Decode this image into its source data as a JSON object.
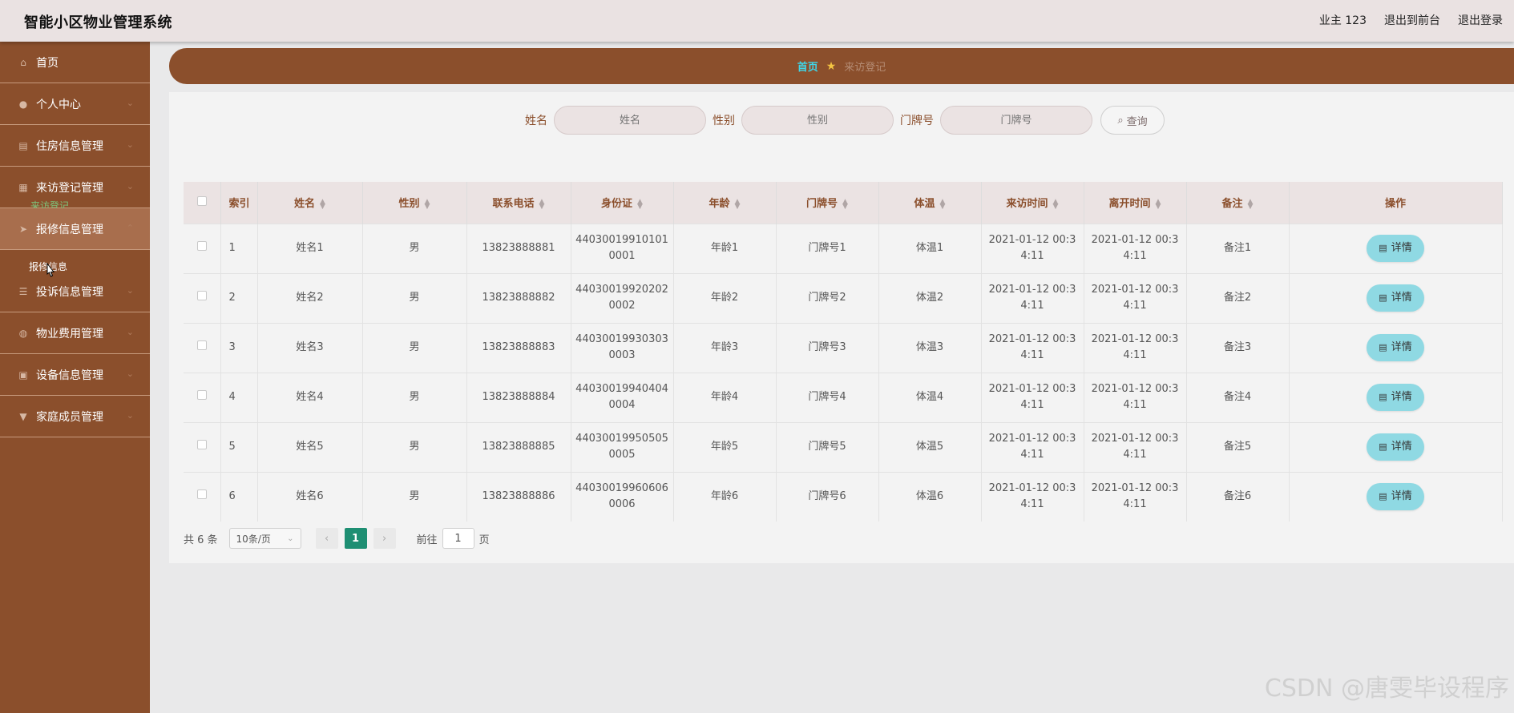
{
  "header": {
    "title": "智能小区物业管理系统",
    "links": [
      "业主 123",
      "退出到前台",
      "退出登录"
    ]
  },
  "sidebar": {
    "items": [
      {
        "label": "首页",
        "icon": "home-icon"
      },
      {
        "label": "个人中心",
        "icon": "user-icon"
      },
      {
        "label": "住房信息管理",
        "icon": "clipboard-icon"
      },
      {
        "label": "来访登记管理",
        "icon": "grid-icon"
      },
      {
        "label": "报修信息管理",
        "icon": "send-icon"
      },
      {
        "label": "投诉信息管理",
        "icon": "sliders-icon"
      },
      {
        "label": "物业费用管理",
        "icon": "chat-icon"
      },
      {
        "label": "设备信息管理",
        "icon": "briefcase-icon"
      },
      {
        "label": "家庭成员管理",
        "icon": "stamp-icon"
      }
    ],
    "submenu_ghost_1": "来访登记",
    "submenu_ghost_2": "报修信息"
  },
  "breadcrumb": {
    "home": "首页",
    "current": "来访登记"
  },
  "search": {
    "name_label": "姓名",
    "name_placeholder": "姓名",
    "gender_label": "性别",
    "gender_placeholder": "性别",
    "door_label": "门牌号",
    "door_placeholder": "门牌号",
    "query_label": "查询"
  },
  "table": {
    "headers": [
      "索引",
      "姓名",
      "性别",
      "联系电话",
      "身份证",
      "年龄",
      "门牌号",
      "体温",
      "来访时间",
      "离开时间",
      "备注",
      "操作"
    ],
    "rows": [
      [
        "1",
        "姓名1",
        "男",
        "13823888881",
        "44030019910101 0001",
        "年龄1",
        "门牌号1",
        "体温1",
        "2021-01-12 00:3 4:11",
        "2021-01-12 00:3 4:11",
        "备注1"
      ],
      [
        "2",
        "姓名2",
        "男",
        "13823888882",
        "44030019920202 0002",
        "年龄2",
        "门牌号2",
        "体温2",
        "2021-01-12 00:3 4:11",
        "2021-01-12 00:3 4:11",
        "备注2"
      ],
      [
        "3",
        "姓名3",
        "男",
        "13823888883",
        "44030019930303 0003",
        "年龄3",
        "门牌号3",
        "体温3",
        "2021-01-12 00:3 4:11",
        "2021-01-12 00:3 4:11",
        "备注3"
      ],
      [
        "4",
        "姓名4",
        "男",
        "13823888884",
        "44030019940404 0004",
        "年龄4",
        "门牌号4",
        "体温4",
        "2021-01-12 00:3 4:11",
        "2021-01-12 00:3 4:11",
        "备注4"
      ],
      [
        "5",
        "姓名5",
        "男",
        "13823888885",
        "44030019950505 0005",
        "年龄5",
        "门牌号5",
        "体温5",
        "2021-01-12 00:3 4:11",
        "2021-01-12 00:3 4:11",
        "备注5"
      ],
      [
        "6",
        "姓名6",
        "男",
        "13823888886",
        "44030019960606 0006",
        "年龄6",
        "门牌号6",
        "体温6",
        "2021-01-12 00:3 4:11",
        "2021-01-12 00:3 4:11",
        "备注6"
      ]
    ],
    "detail_label": "详情"
  },
  "pagination": {
    "total": "共 6 条",
    "page_size": "10条/页",
    "current_page": "1",
    "goto_label": "前往",
    "goto_value": "1",
    "page_suffix": "页"
  },
  "watermark": "CSDN @唐雯毕设程序"
}
